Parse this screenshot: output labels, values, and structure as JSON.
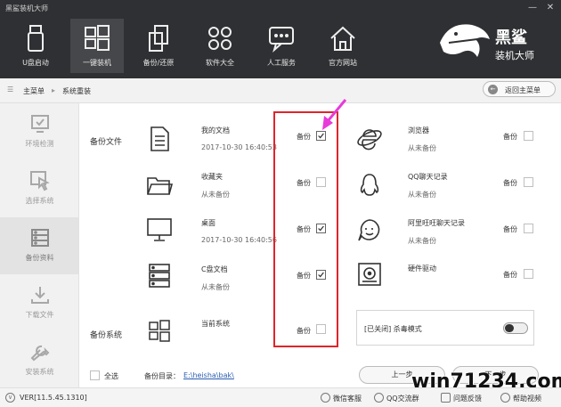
{
  "app": {
    "title": "黑鲨装机大师",
    "minimize": "—",
    "close": "✕"
  },
  "nav": [
    {
      "label": "U盘启动",
      "icon": "usb-drive-icon"
    },
    {
      "label": "一键装机",
      "icon": "windows-logo-icon",
      "active": true
    },
    {
      "label": "备份/还原",
      "icon": "copy-restore-icon"
    },
    {
      "label": "软件大全",
      "icon": "apps-grid-icon"
    },
    {
      "label": "人工服务",
      "icon": "chat-bubble-icon"
    },
    {
      "label": "官方网站",
      "icon": "home-icon"
    }
  ],
  "logo": {
    "line1": "黑鲨",
    "line2": "装机大师"
  },
  "breadcrumb": {
    "home": "主菜单",
    "current": "系统重装",
    "back_button": "返回主菜单"
  },
  "sidebar": [
    {
      "label": "环境检测",
      "icon": "monitor-check-icon"
    },
    {
      "label": "选择系统",
      "icon": "cursor-select-icon"
    },
    {
      "label": "备份资料",
      "icon": "database-icon",
      "active": true
    },
    {
      "label": "下载文件",
      "icon": "download-icon"
    },
    {
      "label": "安装系统",
      "icon": "wrench-icon"
    }
  ],
  "sections": {
    "backup_files": "备份文件",
    "backup_system": "备份系统"
  },
  "left_items": [
    {
      "name": "我的文档",
      "status": "2017-10-30 16:40:53",
      "backup_label": "备份",
      "checked": true,
      "icon": "document-icon"
    },
    {
      "name": "收藏夹",
      "status": "从未备份",
      "backup_label": "备份",
      "checked": false,
      "icon": "folder-icon"
    },
    {
      "name": "桌面",
      "status": "2017-10-30 16:40:56",
      "backup_label": "备份",
      "checked": true,
      "icon": "desktop-monitor-icon"
    },
    {
      "name": "C盘文档",
      "status": "从未备份",
      "backup_label": "备份",
      "checked": true,
      "icon": "server-disk-icon"
    },
    {
      "name": "当前系统",
      "status": "",
      "backup_label": "备份",
      "checked": false,
      "icon": "windows-logo-icon"
    }
  ],
  "right_items": [
    {
      "name": "浏览器",
      "status": "从未备份",
      "backup_label": "备份",
      "checked": false,
      "icon": "ie-browser-icon"
    },
    {
      "name": "QQ聊天记录",
      "status": "从未备份",
      "backup_label": "备份",
      "checked": false,
      "icon": "qq-penguin-icon"
    },
    {
      "name": "阿里旺旺聊天记录",
      "status": "从未备份",
      "backup_label": "备份",
      "checked": false,
      "icon": "aliwangwang-icon"
    },
    {
      "name": "硬件驱动",
      "status": "",
      "backup_label": "备份",
      "checked": false,
      "icon": "hardware-driver-icon"
    }
  ],
  "antivirus": {
    "label": "[已关闭] 杀毒模式",
    "on": false
  },
  "footer": {
    "select_all": "全选",
    "dir_label": "备份目录：",
    "dir_path": "E:\\heisha\\bak\\",
    "prev_button": "上一步",
    "next_button": "下一步"
  },
  "statusbar": {
    "version": "VER[11.5.45.1310]",
    "wechat": "微信客服",
    "qq": "QQ交流群",
    "feedback": "问题反馈",
    "help": "帮助视频"
  },
  "watermark": "win71234.com",
  "colors": {
    "topbar": "#2f3033",
    "highlight_box": "#e0242b",
    "arrow": "#e83ad8",
    "accent_dark": "#333333"
  }
}
